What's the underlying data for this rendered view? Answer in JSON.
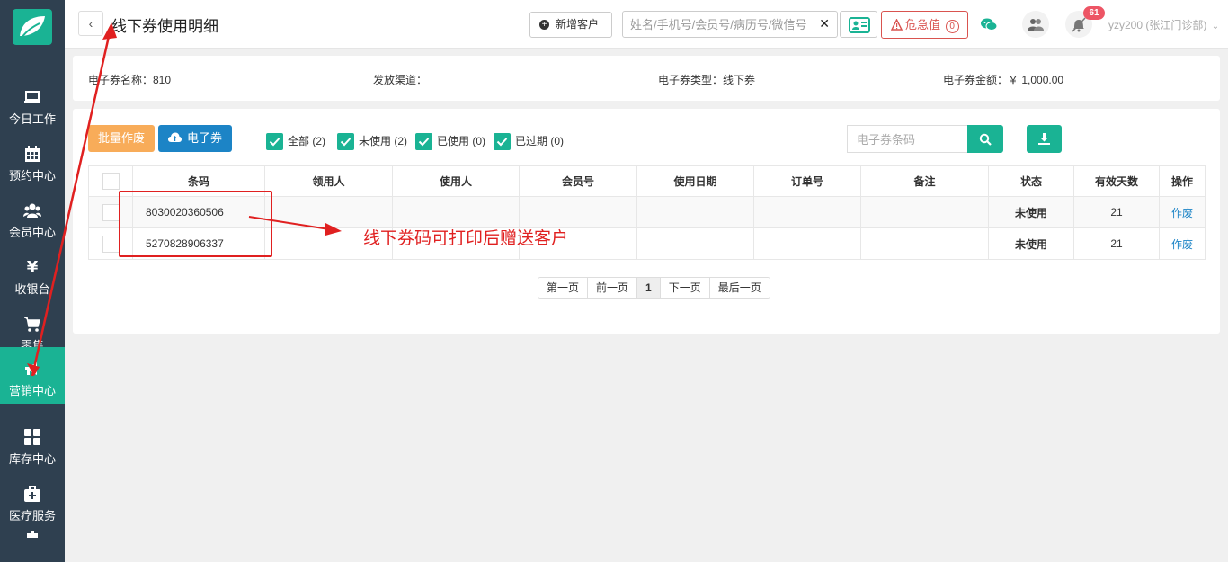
{
  "sidebar": {
    "items": [
      {
        "label": "今日工作",
        "icon": "laptop-icon"
      },
      {
        "label": "预约中心",
        "icon": "calendar-icon"
      },
      {
        "label": "会员中心",
        "icon": "users-icon"
      },
      {
        "label": "收银台",
        "icon": "yen-icon"
      },
      {
        "label": "零售",
        "icon": "cart-icon"
      },
      {
        "label": "营销中心",
        "icon": "bullhorn-icon"
      },
      {
        "label": "库存中心",
        "icon": "grid-icon"
      },
      {
        "label": "医疗服务",
        "icon": "medkit-icon"
      }
    ],
    "active_index": 5
  },
  "header": {
    "title": "线下券使用明细",
    "new_customer": "新增客户",
    "search_placeholder": "姓名/手机号/会员号/病历号/微信号",
    "danger_label": "危急值",
    "danger_count": "0",
    "notify_count": "61",
    "user": "yzy200 (张江门诊部)"
  },
  "info": {
    "name": "电子券名称：810",
    "channel": "发放渠道：",
    "type": "电子券类型：线下券",
    "amount": "电子券金额：￥ 1,000.00"
  },
  "toolbar": {
    "void_label": "批量作废",
    "ecoupon_label": "电子券",
    "filters": [
      {
        "label": "全部 (2)"
      },
      {
        "label": "未使用 (2)"
      },
      {
        "label": "已使用 (0)"
      },
      {
        "label": "已过期 (0)"
      }
    ],
    "code_placeholder": "电子券条码"
  },
  "table": {
    "headers": [
      "条码",
      "领用人",
      "使用人",
      "会员号",
      "使用日期",
      "订单号",
      "备注",
      "状态",
      "有效天数",
      "操作"
    ],
    "rows": [
      {
        "code": "8030020360506",
        "receiver": "",
        "user": "",
        "member": "",
        "date": "",
        "order": "",
        "note": "",
        "status": "未使用",
        "days": "21",
        "op": "作废"
      },
      {
        "code": "5270828906337",
        "receiver": "",
        "user": "",
        "member": "",
        "date": "",
        "order": "",
        "note": "",
        "status": "未使用",
        "days": "21",
        "op": "作废"
      }
    ]
  },
  "pager": {
    "first": "第一页",
    "prev": "前一页",
    "current": "1",
    "next": "下一页",
    "last": "最后一页"
  },
  "annotation": {
    "text": "线下券码可打印后赠送客户"
  },
  "colors": {
    "sidebar_bg": "#2f4050",
    "accent": "#1ab394",
    "warning": "#f8ac59",
    "primary": "#1c84c6",
    "danger": "#e02020"
  }
}
